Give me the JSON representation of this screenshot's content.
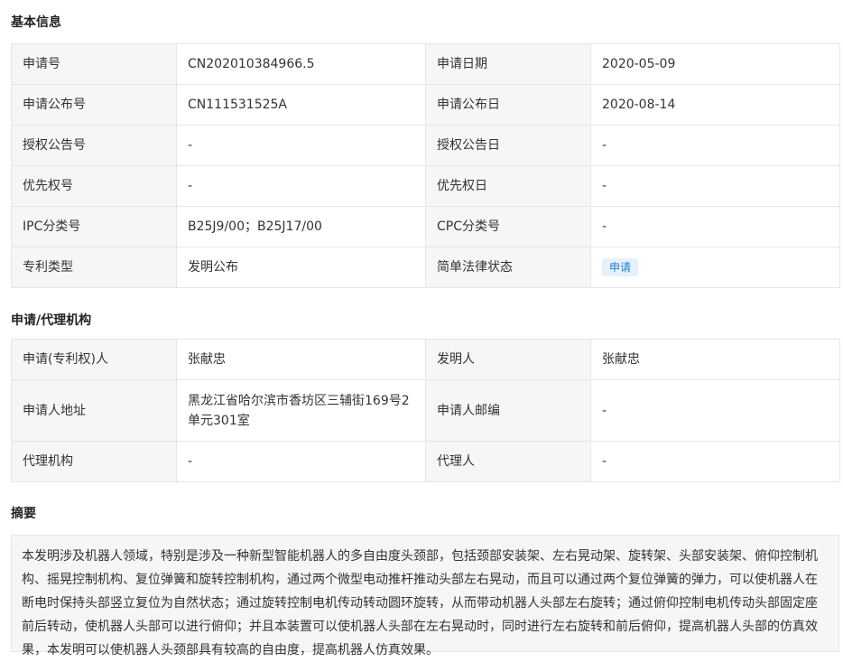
{
  "basic_info": {
    "title": "基本信息",
    "rows": [
      {
        "l1": "申请号",
        "v1": "CN202010384966.5",
        "l2": "申请日期",
        "v2": "2020-05-09"
      },
      {
        "l1": "申请公布号",
        "v1": "CN111531525A",
        "l2": "申请公布日",
        "v2": "2020-08-14"
      },
      {
        "l1": "授权公告号",
        "v1": "-",
        "l2": "授权公告日",
        "v2": "-"
      },
      {
        "l1": "优先权号",
        "v1": "-",
        "l2": "优先权日",
        "v2": "-"
      },
      {
        "l1": "IPC分类号",
        "v1": "B25J9/00；B25J17/00",
        "l2": "CPC分类号",
        "v2": "-"
      },
      {
        "l1": "专利类型",
        "v1": "发明公布",
        "l2": "简单法律状态",
        "v2": "申请"
      }
    ]
  },
  "agency": {
    "title": "申请/代理机构",
    "rows": [
      {
        "l1": "申请(专利权)人",
        "v1": "张献忠",
        "l2": "发明人",
        "v2": "张献忠"
      },
      {
        "l1": "申请人地址",
        "v1": "黑龙江省哈尔滨市香坊区三辅街169号2单元301室",
        "l2": "申请人邮编",
        "v2": "-"
      },
      {
        "l1": "代理机构",
        "v1": "-",
        "l2": "代理人",
        "v2": "-"
      }
    ]
  },
  "abstract": {
    "title": "摘要",
    "text": "本发明涉及机器人领域，特别是涉及一种新型智能机器人的多自由度头颈部，包括颈部安装架、左右晃动架、旋转架、头部安装架、俯仰控制机构、摇晃控制机构、复位弹簧和旋转控制机构，通过两个微型电动推杆推动头部左右晃动，而且可以通过两个复位弹簧的弹力，可以使机器人在断电时保持头部竖立复位为自然状态；通过旋转控制电机传动转动圆环旋转，从而带动机器人头部左右旋转；通过俯仰控制电机传动头部固定座前后转动，使机器人头部可以进行俯仰；并且本装置可以使机器人头部在左右晃动时，同时进行左右旋转和前后俯仰，提高机器人头部的仿真效果，本发明可以使机器人头颈部具有较高的自由度，提高机器人仿真效果。"
  },
  "colors": {
    "label_bg": "#f5f6f8",
    "border": "#e6e6e6",
    "badge_bg": "#e6f2fb",
    "badge_text": "#1d7fd6"
  }
}
